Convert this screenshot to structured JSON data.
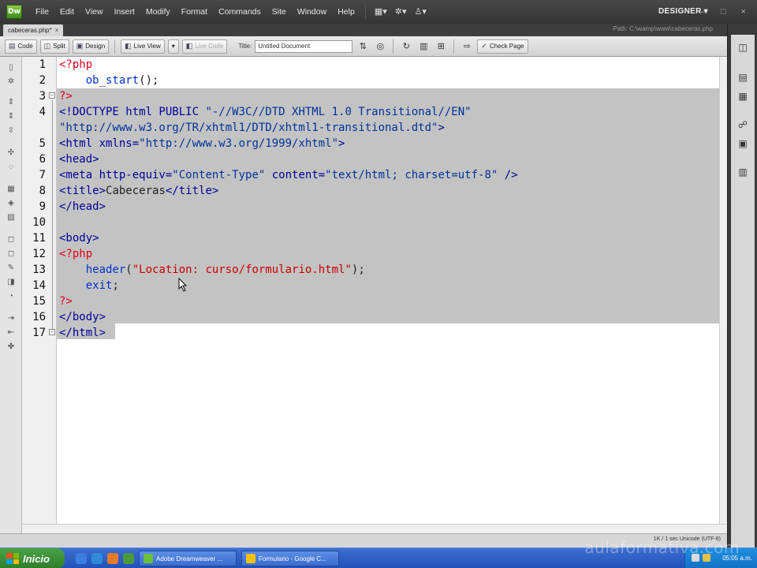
{
  "app": {
    "logo_text": "Dw",
    "menu": [
      "File",
      "Edit",
      "View",
      "Insert",
      "Modify",
      "Format",
      "Commands",
      "Site",
      "Window",
      "Help"
    ],
    "workspace": "DESIGNER ▾",
    "window_controls": "–  □  ×"
  },
  "document": {
    "tab_label": "cabeceras.php*",
    "tab_close": "×",
    "path": "Path: C:\\wamp\\www\\cabeceras.php"
  },
  "toolbar": {
    "code_label": "Code",
    "split_label": "Split",
    "design_label": "Design",
    "live_view_label": "Live View",
    "live_code_label": "Live Code",
    "title_label": "Title:",
    "title_value": "Untitled Document",
    "check_page_label": "Check Page"
  },
  "editor": {
    "line_numbers": [
      "1",
      "2",
      "3",
      "4",
      "5",
      "6",
      "7",
      "8",
      "9",
      "10",
      "11",
      "12",
      "13",
      "14",
      "15",
      "16",
      "17"
    ],
    "lines": {
      "l1": "<?php",
      "l2_fn": "    ob_start",
      "l2_rest": "();",
      "l3": "?>",
      "l4a": "<!DOCTYPE html PUBLIC ",
      "l4b": "\"-//W3C//DTD XHTML 1.0 Transitional//EN\"",
      "l4c": "\"http://www.w3.org/TR/xhtml1/DTD/xhtml1-transitional.dtd\"",
      "l4d": ">",
      "l5a": "<html xmlns=",
      "l5b": "\"http://www.w3.org/1999/xhtml\"",
      "l5c": ">",
      "l6": "<head>",
      "l7a": "<meta http-equiv=",
      "l7b": "\"Content-Type\"",
      "l7c": " content=",
      "l7d": "\"text/html; charset=utf-8\"",
      "l7e": " />",
      "l8a": "<title>",
      "l8b": "Cabeceras",
      "l8c": "</title>",
      "l9": "</head>",
      "l11": "<body>",
      "l12": "<?php",
      "l13_fn": "    header",
      "l13_p1": "(",
      "l13_str": "\"Location: curso/formulario.html\"",
      "l13_p2": ");",
      "l14_fn": "    exit",
      "l14_rest": ";",
      "l15": "?>",
      "l16": "</body>",
      "l17": "</html>"
    }
  },
  "status": {
    "right": "1K / 1 sec  Unicode (UTF-8)"
  },
  "taskbar": {
    "start_label": "Inicio",
    "tasks": [
      "Adobe Dreamweaver ...",
      "Formulario - Google C..."
    ],
    "clock": "05:05 a.m."
  },
  "watermark": "aulaformativa.com",
  "colors": {
    "php_delim": "#e3001b",
    "html_tag": "#000099",
    "php_string": "#cc0000",
    "selection": "#c3c3c3"
  }
}
